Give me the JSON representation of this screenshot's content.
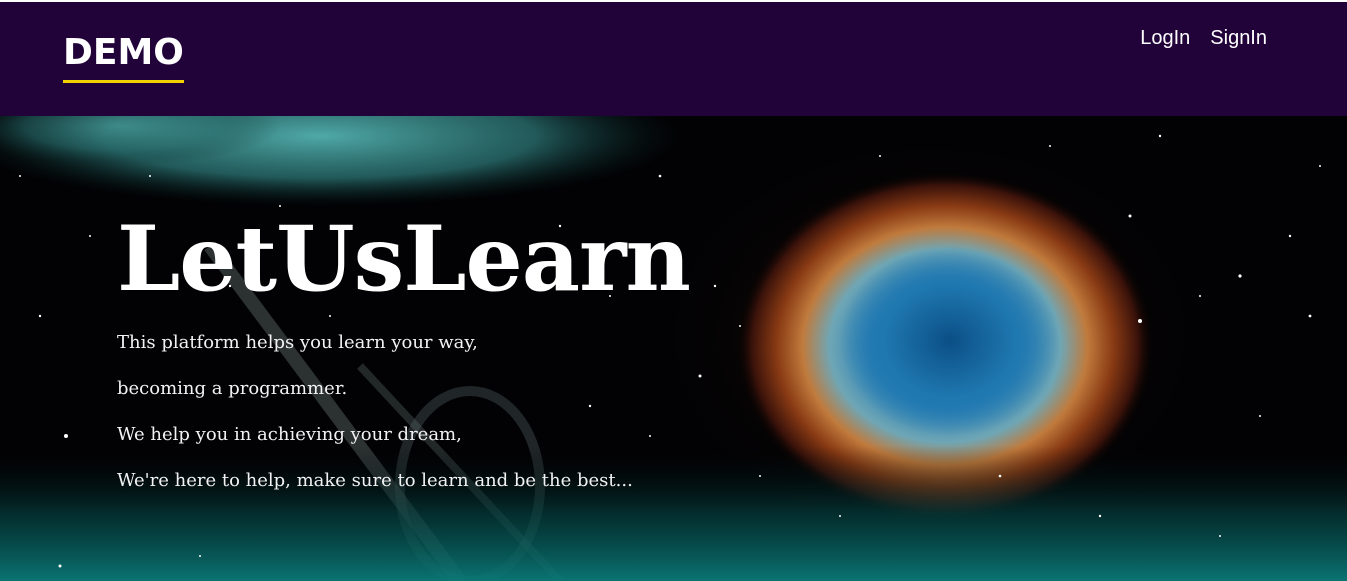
{
  "navbar": {
    "brand": "DEMO",
    "links": [
      {
        "label": "LogIn"
      },
      {
        "label": "SignIn"
      }
    ],
    "background": "#21033a",
    "brand_underline_color": "#f2d200"
  },
  "hero": {
    "background_image": "space-nebula-image",
    "title": "LetUsLearn",
    "lines": [
      "This platform helps you learn your way,",
      "becoming a programmer.",
      "We help you in achieving your dream,",
      "We're here to help, make sure to learn and be the best..."
    ]
  }
}
